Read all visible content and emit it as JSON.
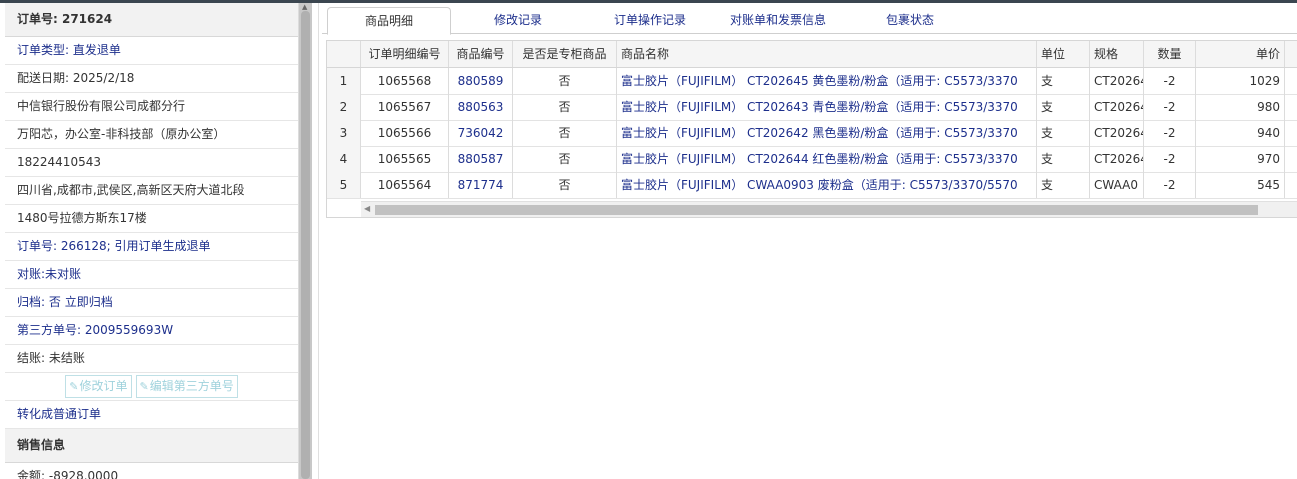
{
  "order": {
    "title": "订单号: 271624",
    "type": "订单类型: 直发退单",
    "delivery_date": "配送日期: 2025/2/18",
    "company": "中信银行股份有限公司成都分行",
    "contact": "万阳芯，办公室-非科技部（原办公室）",
    "phone": "18224410543",
    "address_line1": "四川省,成都市,武侯区,高新区天府大道北段",
    "address_line2": "1480号拉德方斯东17楼",
    "ref_order": "订单号: 266128; 引用订单生成退单",
    "reconcile_label": "对账:",
    "reconcile_value": "未对账",
    "archive_label": "归档:",
    "archive_value": "否 立即归档",
    "third_party": "第三方单号: 2009559693W",
    "settle": "结账: 未结账",
    "edit_order_btn": "修改订单",
    "edit_third_btn": "编辑第三方单号",
    "convert_link": "转化成普通订单",
    "sales_header": "销售信息",
    "amount": "金额: -8928.0000"
  },
  "tabs": [
    "商品明细",
    "修改记录",
    "订单操作记录",
    "对账单和发票信息",
    "包裹状态"
  ],
  "table": {
    "columns": [
      "",
      "订单明细编号",
      "商品编号",
      "是否是专柜商品",
      "商品名称",
      "单位",
      "规格",
      "数量",
      "单价"
    ],
    "rows": [
      {
        "n": "1",
        "detail": "1065568",
        "code": "880589",
        "counter": "否",
        "name": "富士胶片（FUJIFILM） CT202645 黄色墨粉/粉盒（适用于: C5573/3370",
        "unit": "支",
        "spec": "CT20264",
        "qty": "-2",
        "price": "1029"
      },
      {
        "n": "2",
        "detail": "1065567",
        "code": "880563",
        "counter": "否",
        "name": "富士胶片（FUJIFILM） CT202643 青色墨粉/粉盒（适用于: C5573/3370",
        "unit": "支",
        "spec": "CT20264",
        "qty": "-2",
        "price": "980"
      },
      {
        "n": "3",
        "detail": "1065566",
        "code": "736042",
        "counter": "否",
        "name": "富士胶片（FUJIFILM） CT202642 黑色墨粉/粉盒（适用于: C5573/3370",
        "unit": "支",
        "spec": "CT20264",
        "qty": "-2",
        "price": "940"
      },
      {
        "n": "4",
        "detail": "1065565",
        "code": "880587",
        "counter": "否",
        "name": "富士胶片（FUJIFILM） CT202644 红色墨粉/粉盒（适用于: C5573/3370",
        "unit": "支",
        "spec": "CT20264",
        "qty": "-2",
        "price": "970"
      },
      {
        "n": "5",
        "detail": "1065564",
        "code": "871774",
        "counter": "否",
        "name": "富士胶片（FUJIFILM） CWAA0903 废粉盒（适用于: C5573/3370/5570",
        "unit": "支",
        "spec": "CWAA0",
        "qty": "-2",
        "price": "545"
      }
    ]
  },
  "icons": {
    "edit": "edit-icon"
  },
  "colors": {
    "link": "#1d2f8c",
    "header_bg": "#f5f5f5",
    "disabled_button": "#9fd2dc"
  }
}
